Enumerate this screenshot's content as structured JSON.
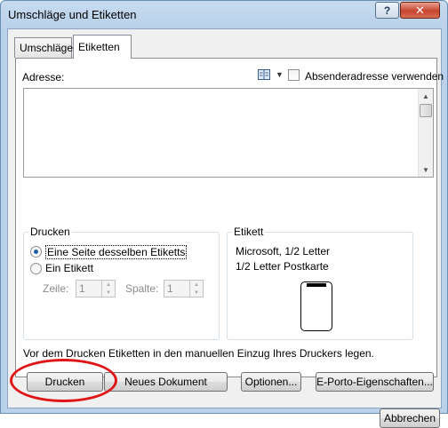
{
  "window": {
    "title": "Umschläge und Etiketten",
    "help_glyph": "?",
    "close_glyph": "✕"
  },
  "tabs": [
    {
      "label": "Umschläge",
      "active": false
    },
    {
      "label": "Etiketten",
      "active": true
    }
  ],
  "address": {
    "label": "Adresse:",
    "value": "",
    "return_address_checkbox_label": "Absenderadresse verwenden",
    "return_address_checked": false
  },
  "print_group": {
    "title": "Drucken",
    "option_full_page": "Eine Seite desselben Etiketts",
    "option_single": "Ein Etikett",
    "selected": "full_page",
    "row_label": "Zeile:",
    "row_value": "1",
    "column_label": "Spalte:",
    "column_value": "1"
  },
  "label_group": {
    "title": "Etikett",
    "vendor_line": "Microsoft,  1/2 Letter",
    "product_line": "1/2 Letter Postkarte"
  },
  "note": "Vor dem Drucken Etiketten in den manuellen Einzug Ihres Druckers legen.",
  "buttons": {
    "print": "Drucken",
    "new_document": "Neues Dokument",
    "options": "Optionen...",
    "eporto": "E-Porto-Eigenschaften...",
    "cancel": "Abbrechen"
  },
  "annotation_color": "#e01515"
}
